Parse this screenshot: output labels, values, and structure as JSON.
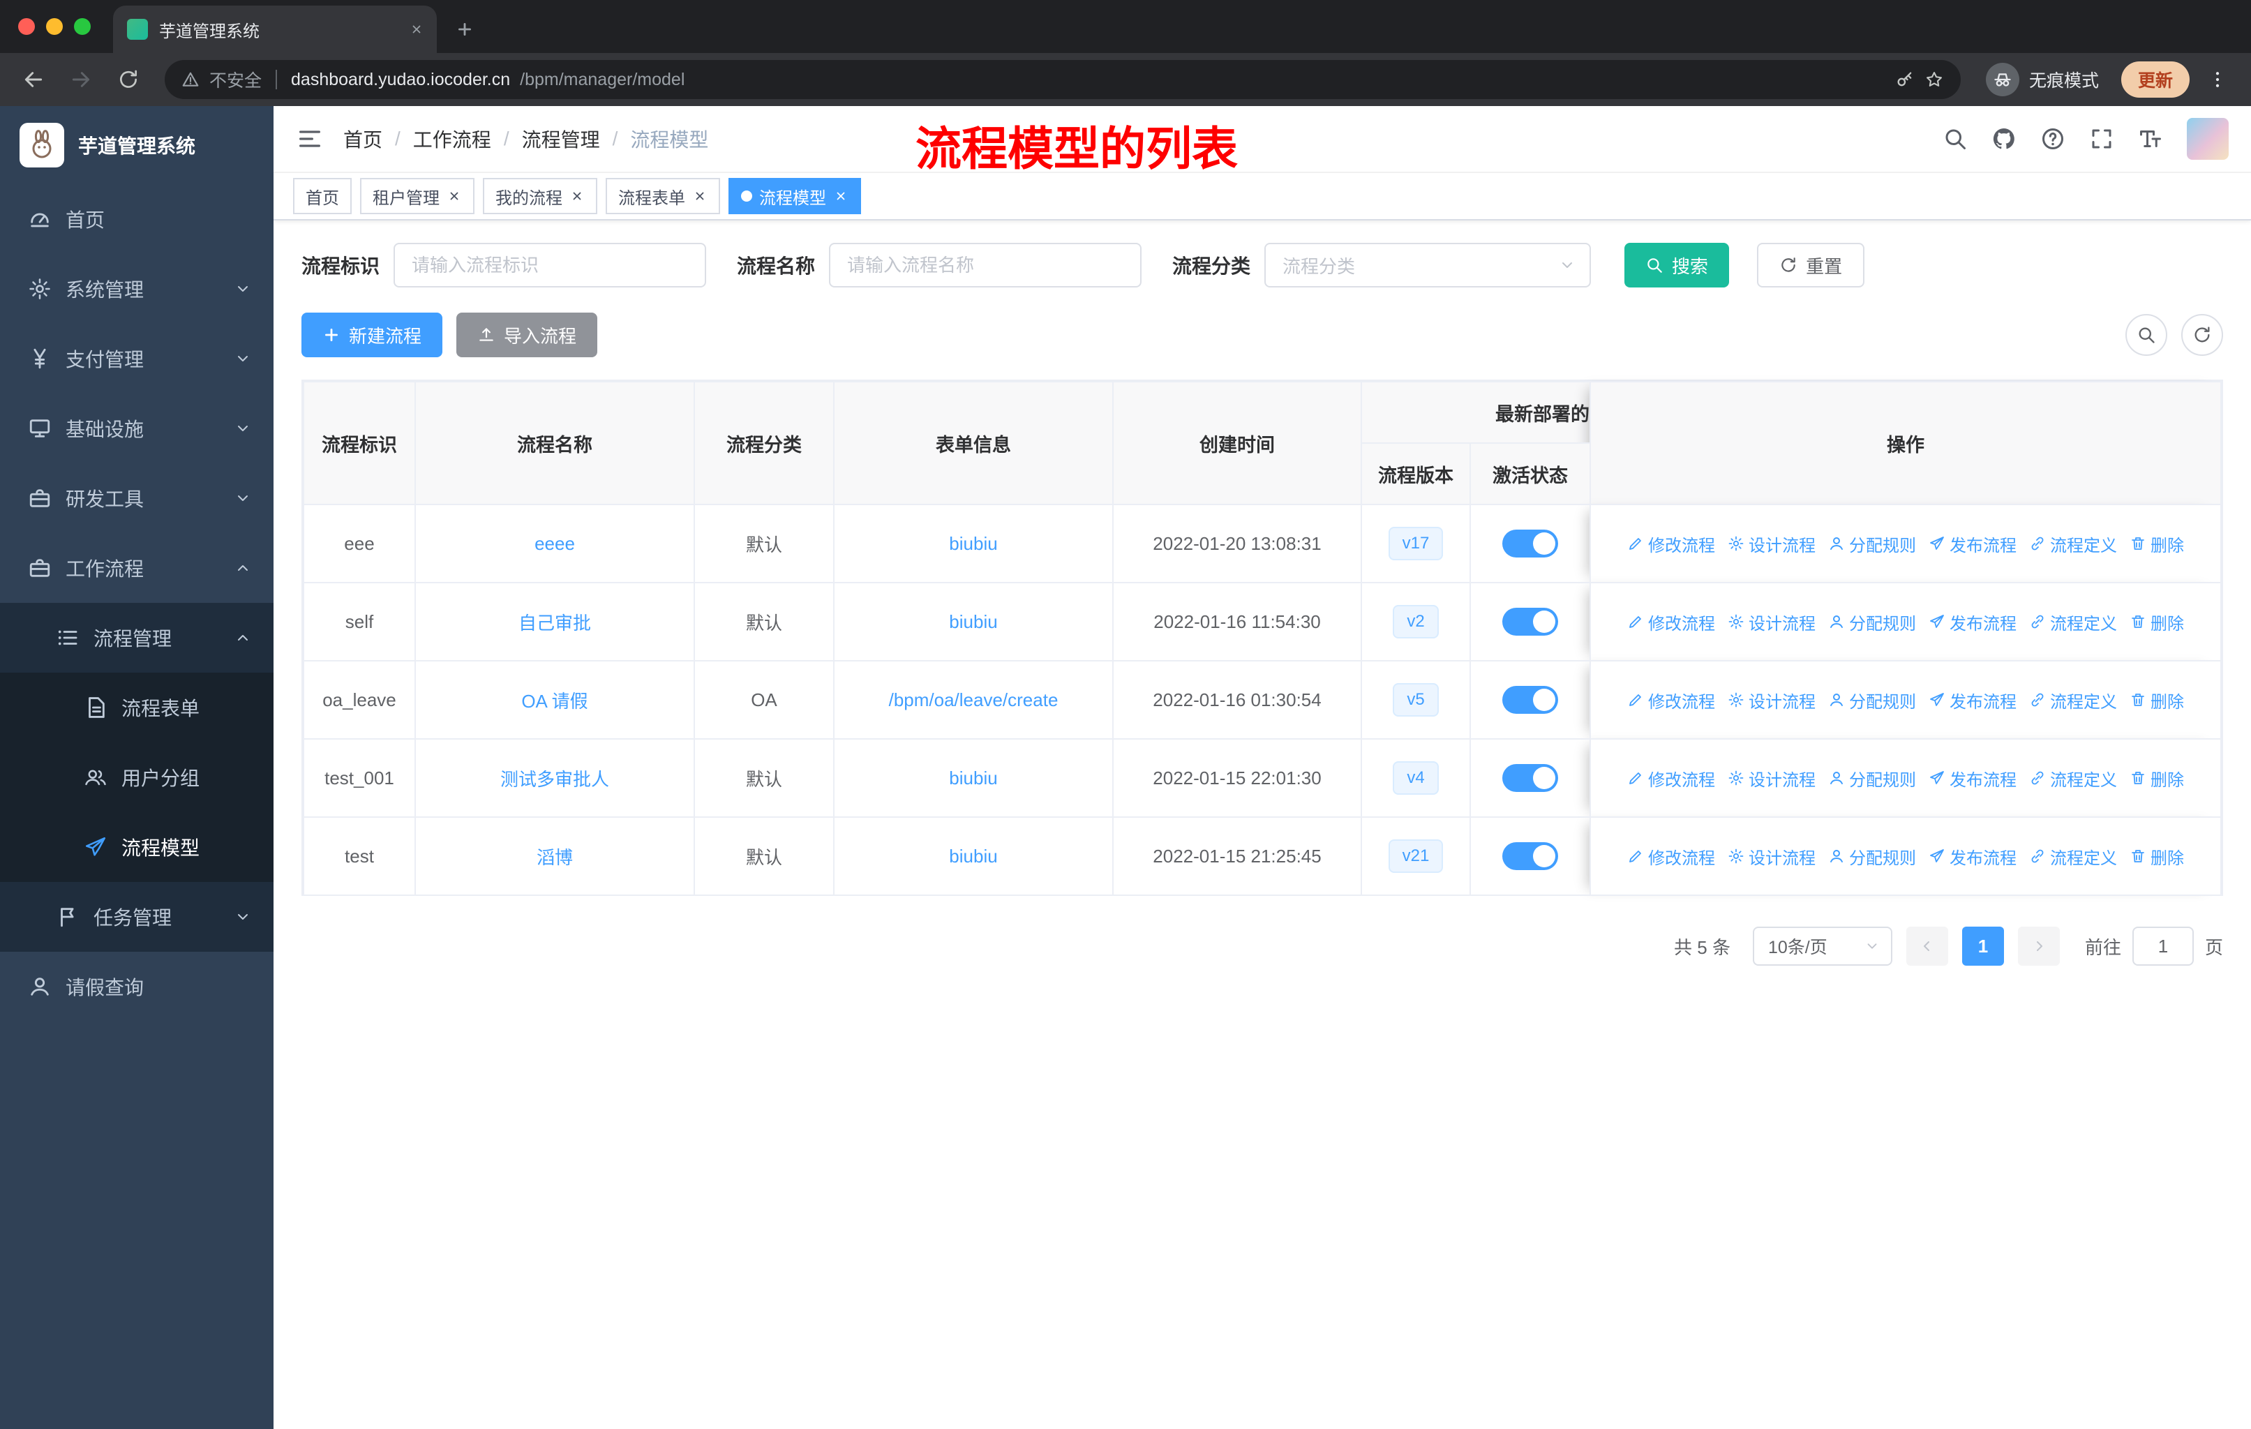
{
  "browser": {
    "tab_title": "芋道管理系统",
    "security_label": "不安全",
    "url_domain": "dashboard.yudao.iocoder.cn",
    "url_path": "/bpm/manager/model",
    "incognito_label": "无痕模式",
    "update_label": "更新"
  },
  "sidebar": {
    "logo_title": "芋道管理系统",
    "items": [
      {
        "label": "首页"
      },
      {
        "label": "系统管理"
      },
      {
        "label": "支付管理"
      },
      {
        "label": "基础设施"
      },
      {
        "label": "研发工具"
      },
      {
        "label": "工作流程"
      },
      {
        "label": "流程管理"
      },
      {
        "label": "流程表单"
      },
      {
        "label": "用户分组"
      },
      {
        "label": "流程模型"
      },
      {
        "label": "任务管理"
      },
      {
        "label": "请假查询"
      }
    ]
  },
  "header": {
    "breadcrumb": [
      "首页",
      "工作流程",
      "流程管理",
      "流程模型"
    ],
    "annotation": "流程模型的列表"
  },
  "tags": [
    {
      "label": "首页"
    },
    {
      "label": "租户管理"
    },
    {
      "label": "我的流程"
    },
    {
      "label": "流程表单"
    },
    {
      "label": "流程模型"
    }
  ],
  "filters": {
    "key_label": "流程标识",
    "key_placeholder": "请输入流程标识",
    "name_label": "流程名称",
    "name_placeholder": "请输入流程名称",
    "category_label": "流程分类",
    "category_placeholder": "流程分类",
    "search_label": "搜索",
    "reset_label": "重置"
  },
  "toolbar": {
    "create_label": "新建流程",
    "import_label": "导入流程"
  },
  "table": {
    "headers": {
      "key": "流程标识",
      "name": "流程名称",
      "category": "流程分类",
      "form": "表单信息",
      "created": "创建时间",
      "deploy_group": "最新部署的",
      "version": "流程版本",
      "status": "激活状态",
      "actions": "操作"
    },
    "actions": [
      "修改流程",
      "设计流程",
      "分配规则",
      "发布流程",
      "流程定义",
      "删除"
    ],
    "rows": [
      {
        "key": "eee",
        "name": "eeee",
        "category": "默认",
        "form": "biubiu",
        "created": "2022-01-20 13:08:31",
        "version": "v17",
        "active": true
      },
      {
        "key": "self",
        "name": "自己审批",
        "category": "默认",
        "form": "biubiu",
        "created": "2022-01-16 11:54:30",
        "version": "v2",
        "active": true
      },
      {
        "key": "oa_leave",
        "name": "OA 请假",
        "category": "OA",
        "form": "/bpm/oa/leave/create",
        "created": "2022-01-16 01:30:54",
        "version": "v5",
        "active": true
      },
      {
        "key": "test_001",
        "name": "测试多审批人",
        "category": "默认",
        "form": "biubiu",
        "created": "2022-01-15 22:01:30",
        "version": "v4",
        "active": true
      },
      {
        "key": "test",
        "name": "滔博",
        "category": "默认",
        "form": "biubiu",
        "created": "2022-01-15 21:25:45",
        "version": "v21",
        "active": true
      }
    ]
  },
  "pagination": {
    "total": "共 5 条",
    "page_size": "10条/页",
    "current_page": "1",
    "goto_label": "前往",
    "goto_value": "1",
    "unit_label": "页"
  },
  "colors": {
    "accent": "#409EFF",
    "search_button": "#1ABC9C",
    "sidebar_bg": "#304156",
    "sidebar_sub_bg": "#1F2D3D",
    "annotation_red": "#FE0000",
    "tag_active": "#409EFF",
    "toggle_on": "#409EFF",
    "version_tag_bg": "#ECF5FF"
  }
}
